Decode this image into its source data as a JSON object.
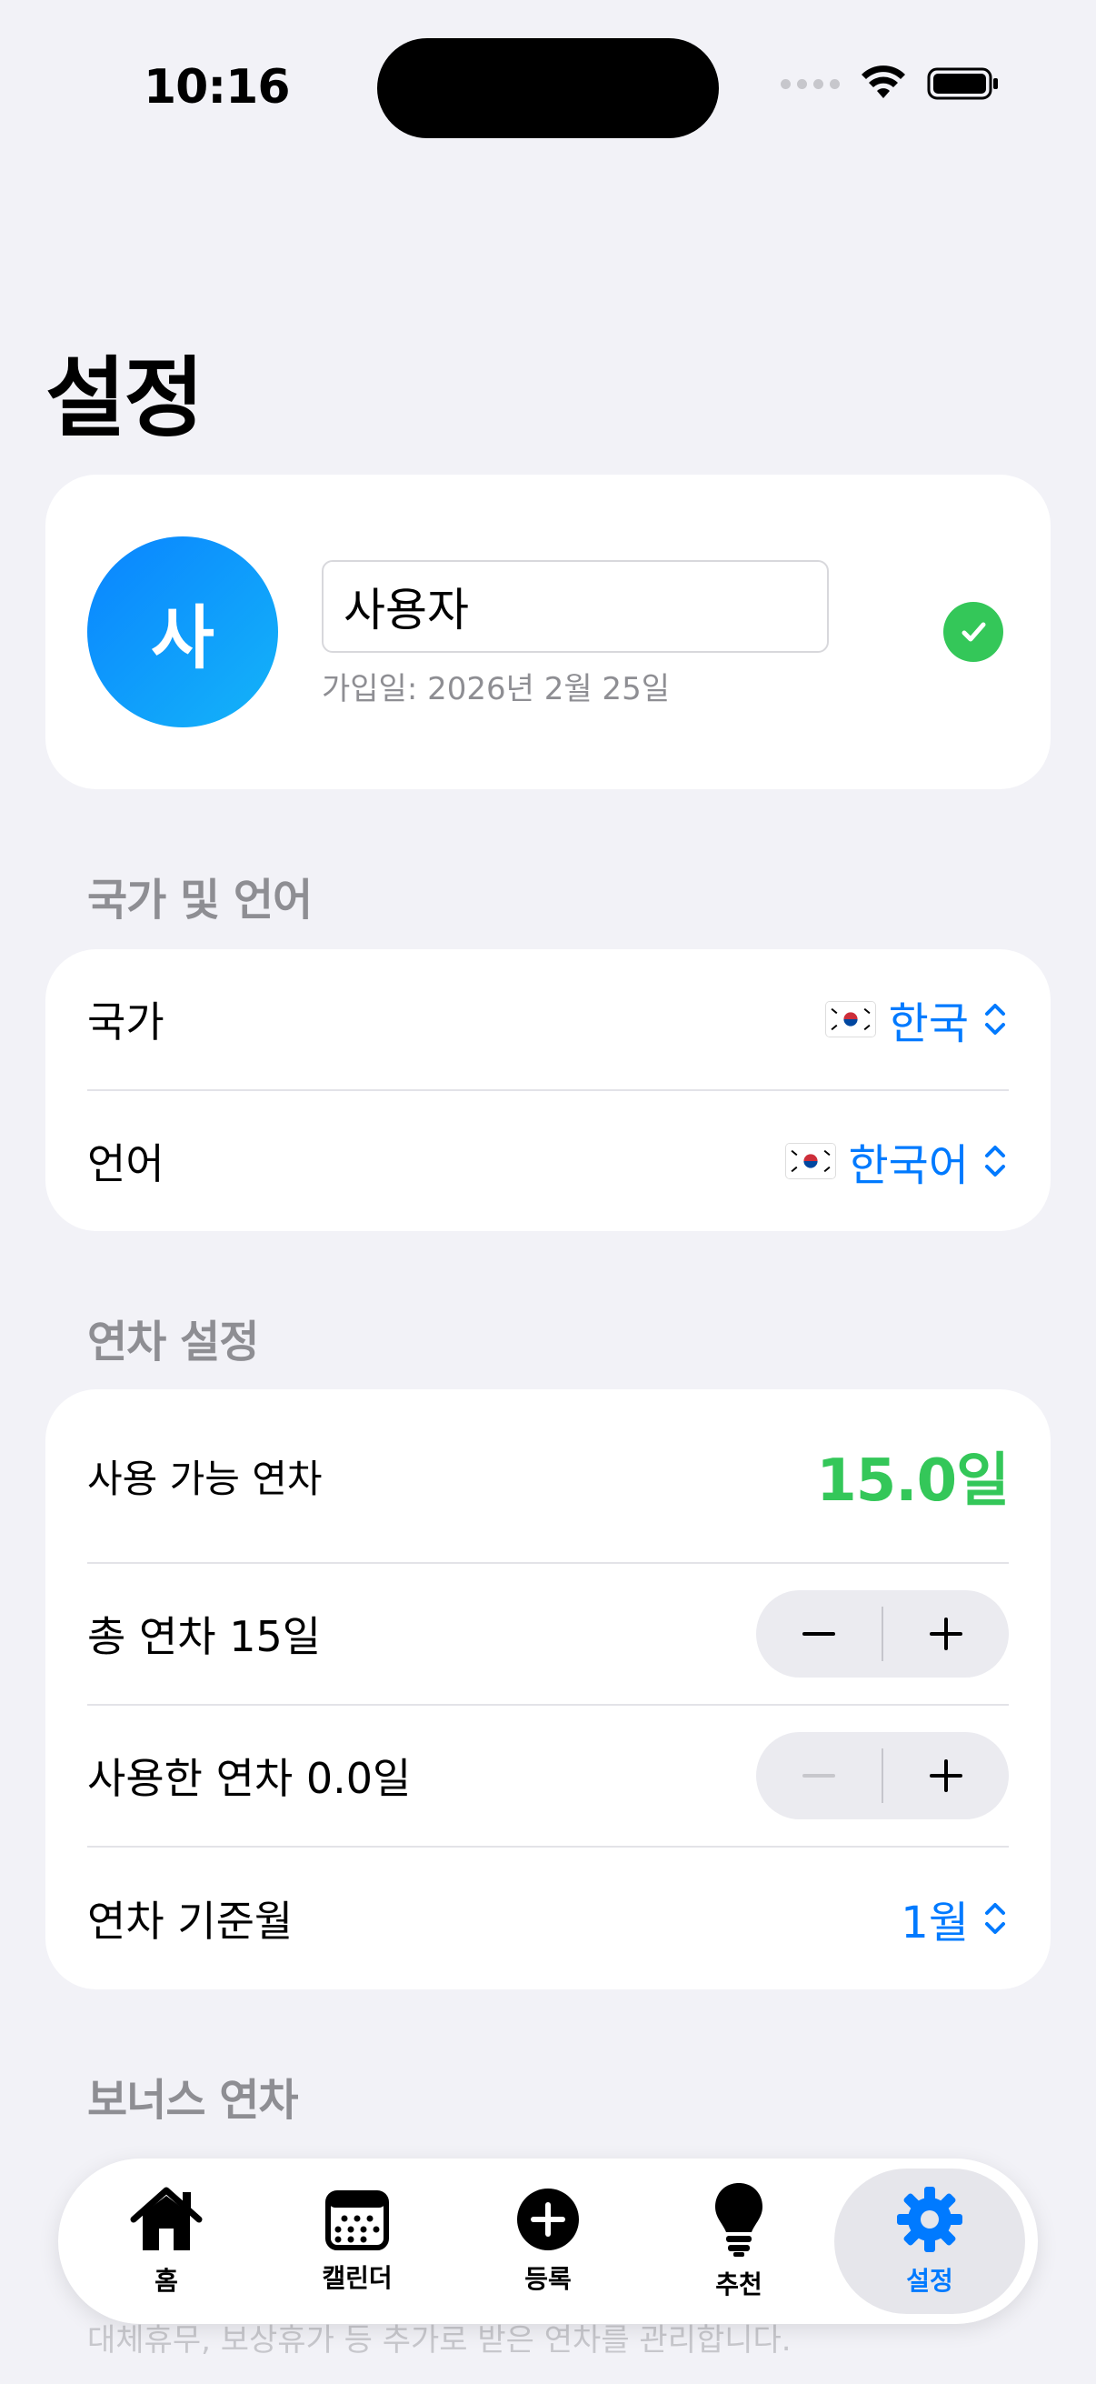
{
  "status_bar": {
    "time": "10:16"
  },
  "page": {
    "title": "설정"
  },
  "profile": {
    "avatar_initial": "사",
    "name_value": "사용자",
    "join_date": "가입일: 2026년 2월 25일"
  },
  "country_language": {
    "header": "국가 및 언어",
    "country_label": "국가",
    "country_value": "한국",
    "language_label": "언어",
    "language_value": "한국어"
  },
  "leave_settings": {
    "header": "연차 설정",
    "available_label": "사용 가능 연차",
    "available_value": "15.0일",
    "total_label": "총 연차  15일",
    "used_label": "사용한 연차  0.0일",
    "base_month_label": "연차 기준월",
    "base_month_value": "1월"
  },
  "bonus": {
    "header": "보너스 연차",
    "description": "대체휴무, 보상휴가 등 추가로 받은 연차를 관리합니다."
  },
  "tab_bar": {
    "tabs": [
      {
        "label": "홈",
        "icon": "house-icon"
      },
      {
        "label": "캘린더",
        "icon": "calendar-icon"
      },
      {
        "label": "등록",
        "icon": "plus-circle-icon"
      },
      {
        "label": "추천",
        "icon": "lightbulb-icon"
      },
      {
        "label": "설정",
        "icon": "gear-icon",
        "active": true
      }
    ]
  },
  "colors": {
    "accent": "#007AFF",
    "success": "#34C759",
    "background": "#F2F2F7"
  }
}
